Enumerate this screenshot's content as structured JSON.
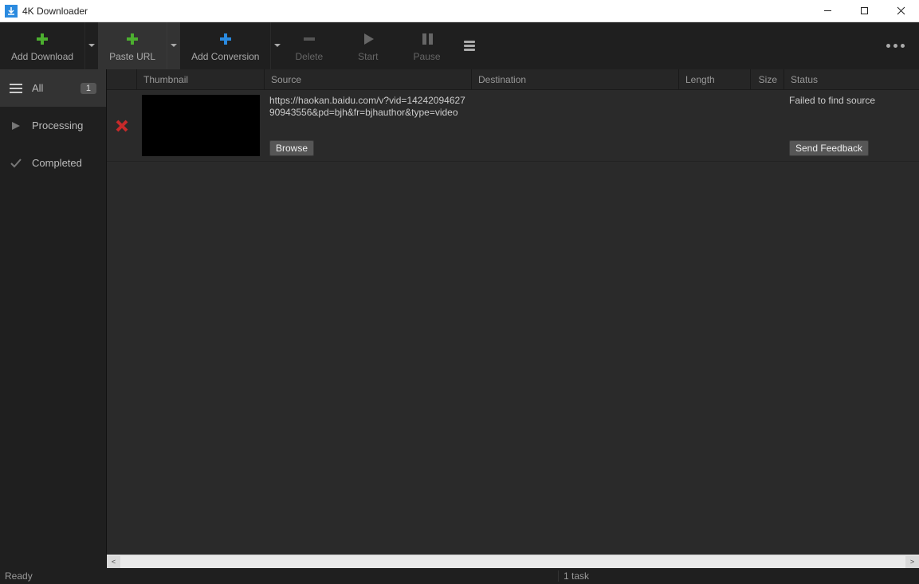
{
  "window": {
    "title": "4K Downloader"
  },
  "toolbar": {
    "add_download": "Add Download",
    "paste_url": "Paste URL",
    "add_conversion": "Add Conversion",
    "delete": "Delete",
    "start": "Start",
    "pause": "Pause"
  },
  "sidebar": {
    "items": [
      {
        "label": "All",
        "badge": "1"
      },
      {
        "label": "Processing"
      },
      {
        "label": "Completed"
      }
    ]
  },
  "columns": {
    "thumbnail": "Thumbnail",
    "source": "Source",
    "destination": "Destination",
    "length": "Length",
    "size": "Size",
    "status": "Status"
  },
  "rows": [
    {
      "source_url": "https://haokan.baidu.com/v?vid=1424209462790943556&pd=bjh&fr=bjhauthor&type=video",
      "browse_label": "Browse",
      "status_text": "Failed to find source",
      "feedback_label": "Send Feedback"
    }
  ],
  "statusbar": {
    "left": "Ready",
    "right": "1 task"
  }
}
